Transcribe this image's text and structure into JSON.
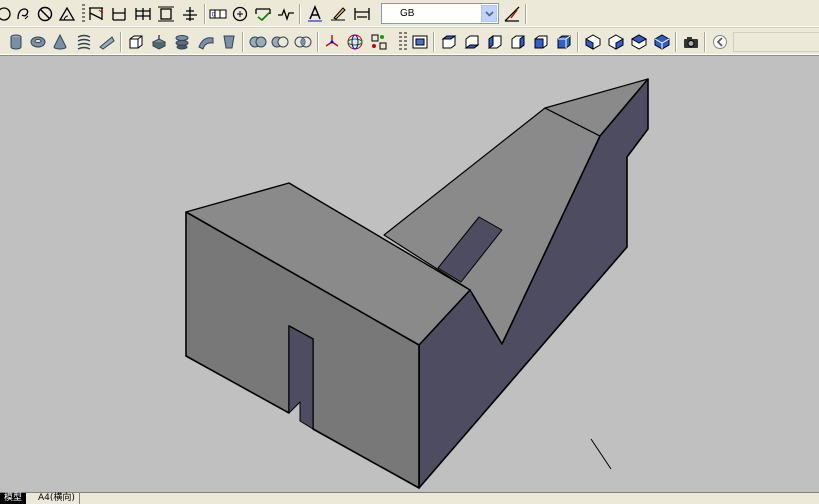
{
  "toolbars": {
    "row1_icons": [
      "circle-icon",
      "spiral-arc-icon",
      "no-entry-icon",
      "angle-icon",
      "linear-dim-icon",
      "aligned-dim-icon",
      "baseline-dim-icon",
      "continue-dim-icon",
      "ordinate-dim-icon",
      "tolerance-icon",
      "center-mark-icon",
      "dim-edit-icon",
      "dim-jog-icon",
      "text-style-icon",
      "dim-text-edit-icon",
      "dim-update-icon"
    ],
    "row2_icons": [
      "cylinder-icon",
      "torus-icon",
      "cone-icon",
      "helix-icon",
      "wedge-icon",
      "box-icon",
      "extrude-icon",
      "revolve-icon",
      "sweep-icon",
      "loft-icon",
      "union-icon",
      "subtract-icon",
      "intersect-icon",
      "3d-move-icon",
      "3d-rotate-icon",
      "3d-align-icon",
      "named-views-icon",
      "top-view-icon",
      "bottom-view-icon",
      "left-view-icon",
      "right-view-icon",
      "front-view-icon",
      "back-view-icon",
      "sw-iso-icon",
      "se-iso-icon",
      "ne-iso-icon",
      "nw-iso-icon",
      "camera-icon",
      "back-arrow-icon"
    ]
  },
  "dim_style": {
    "value": "GB"
  },
  "layout_tabs": {
    "model": "模型",
    "layout1": "A4(横向)"
  },
  "colors": {
    "toolbar_bg": "#ece9d8",
    "viewport_bg": "#c0c0c0",
    "face_top": "#8a8a8a",
    "face_front": "#787878",
    "face_side": "#4e4c60",
    "edge": "#000000"
  }
}
